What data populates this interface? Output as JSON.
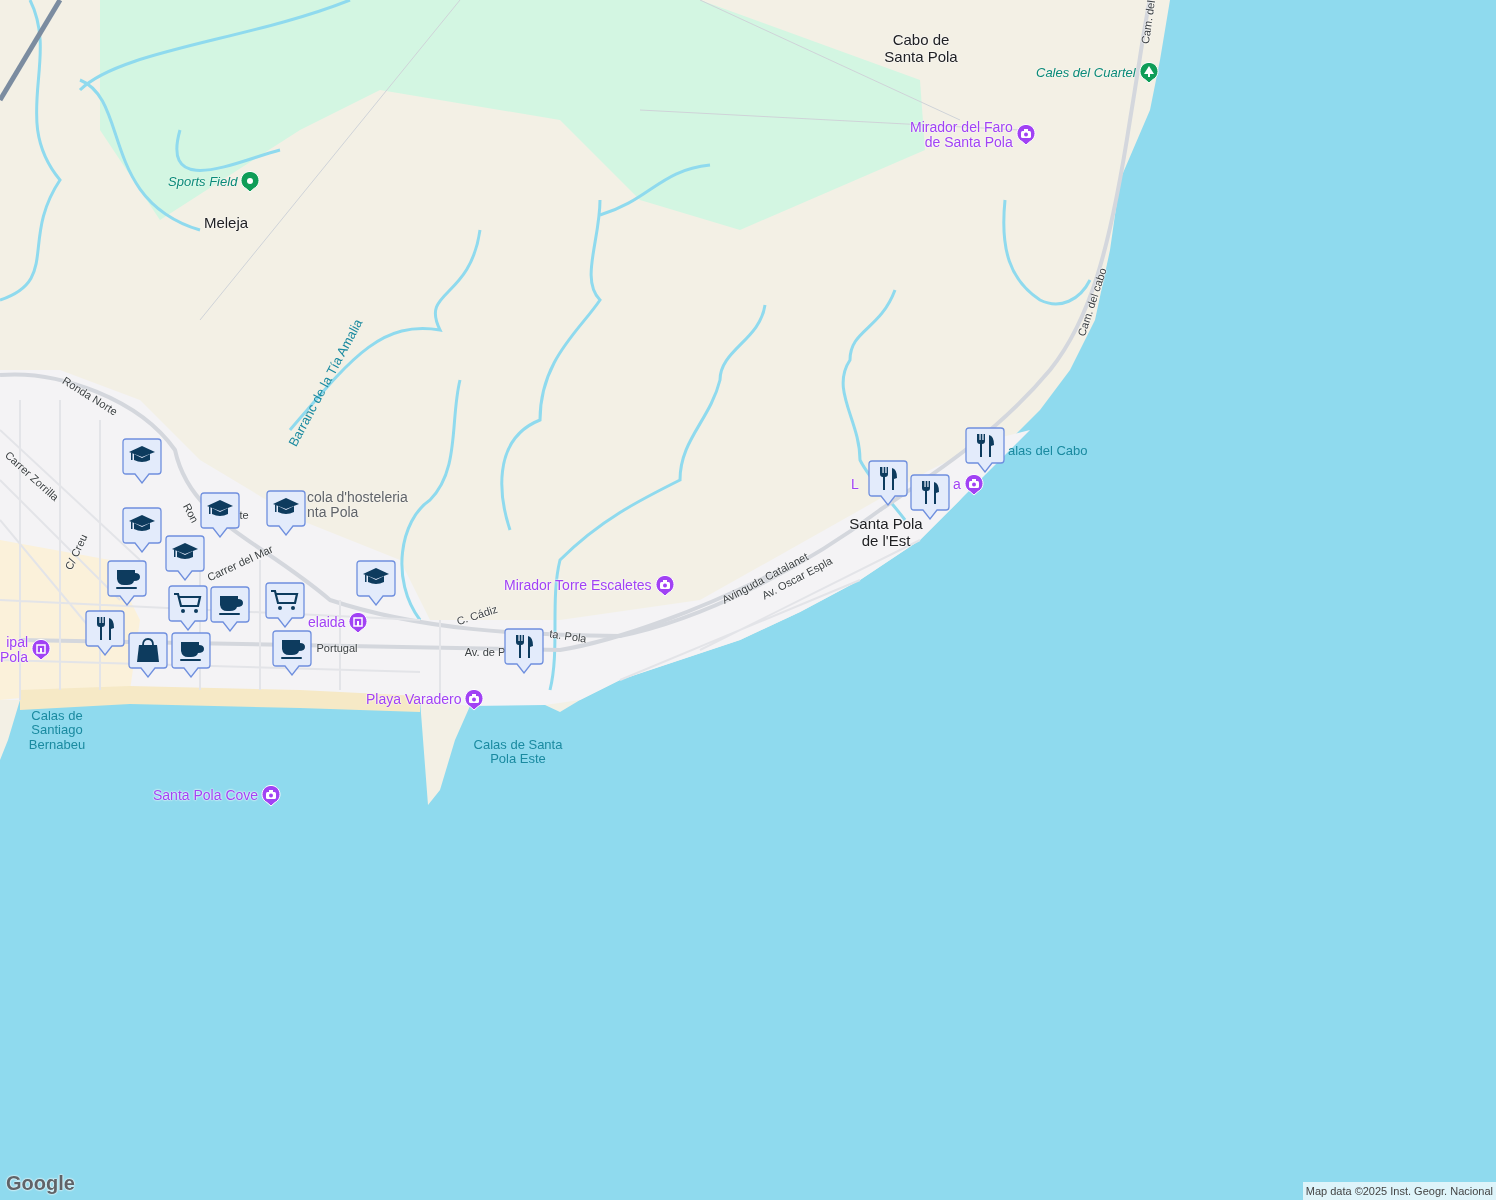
{
  "map": {
    "labels": [
      {
        "kind": "place",
        "lines": [
          "Cabo de",
          "Santa Pola"
        ]
      },
      {
        "kind": "park",
        "lines": [
          "Cales del Cuartel"
        ],
        "pinned": true
      },
      {
        "kind": "poi",
        "lines": [
          "Mirador del Faro",
          "de Santa Pola"
        ],
        "pinned": true
      },
      {
        "kind": "park",
        "lines": [
          "Sports Field"
        ],
        "pinned": true
      },
      {
        "kind": "place",
        "lines": [
          "Meleja"
        ]
      },
      {
        "kind": "water",
        "lines": [
          "Barranc de la Tía Amalia"
        ]
      },
      {
        "kind": "street",
        "lines": [
          "Ronda Norte"
        ]
      },
      {
        "kind": "street",
        "lines": [
          "Carrer Zorrilla"
        ]
      },
      {
        "kind": "street",
        "lines": [
          "C/ Creu"
        ]
      },
      {
        "kind": "street",
        "lines": [
          "Ron"
        ]
      },
      {
        "kind": "street",
        "lines": [
          "te"
        ]
      },
      {
        "kind": "school",
        "lines": [
          "cola d'hosteleria",
          "nta Pola"
        ]
      },
      {
        "kind": "street",
        "lines": [
          "Carrer del Mar"
        ]
      },
      {
        "kind": "poi",
        "lines": [
          "elaida"
        ],
        "pinned": true
      },
      {
        "kind": "street",
        "lines": [
          "Portugal"
        ]
      },
      {
        "kind": "street",
        "lines": [
          "C. Cádiz"
        ]
      },
      {
        "kind": "street",
        "lines": [
          "ta. Pola"
        ]
      },
      {
        "kind": "street",
        "lines": [
          "Av. de P"
        ]
      },
      {
        "kind": "poi",
        "lines": [
          "Mirador Torre Escaletes"
        ],
        "pinned": true
      },
      {
        "kind": "street",
        "lines": [
          "Avinguda Catalanet"
        ]
      },
      {
        "kind": "street",
        "lines": [
          "Av. Oscar Espla"
        ]
      },
      {
        "kind": "poi",
        "lines": [
          "L"
        ]
      },
      {
        "kind": "poi",
        "lines": [
          "a"
        ],
        "pinned": true
      },
      {
        "kind": "place",
        "lines": [
          "Santa Pola",
          "de l'Est"
        ]
      },
      {
        "kind": "water",
        "lines": [
          "alas del Cabo"
        ]
      },
      {
        "kind": "street",
        "lines": [
          "Cam. del cabo"
        ]
      },
      {
        "kind": "street",
        "lines": [
          "Cam. del"
        ]
      },
      {
        "kind": "poi",
        "lines": [
          "ipal",
          "Pola"
        ],
        "pinned": true
      },
      {
        "kind": "water",
        "lines": [
          "Calas de",
          "Santiago",
          "Bernabeu"
        ]
      },
      {
        "kind": "poi",
        "lines": [
          "Playa Varadero"
        ],
        "pinned": true
      },
      {
        "kind": "water",
        "lines": [
          "Calas de Santa",
          "Pola Este"
        ]
      },
      {
        "kind": "poi",
        "lines": [
          "Santa Pola Cove"
        ],
        "pinned": true
      }
    ],
    "markers": [
      {
        "kind": "school"
      },
      {
        "kind": "school"
      },
      {
        "kind": "school"
      },
      {
        "kind": "school"
      },
      {
        "kind": "school"
      },
      {
        "kind": "school"
      },
      {
        "kind": "cafe"
      },
      {
        "kind": "cart"
      },
      {
        "kind": "cart"
      },
      {
        "kind": "cafe"
      },
      {
        "kind": "restaurant"
      },
      {
        "kind": "bag"
      },
      {
        "kind": "cafe"
      },
      {
        "kind": "cafe"
      },
      {
        "kind": "restaurant"
      },
      {
        "kind": "restaurant"
      },
      {
        "kind": "restaurant"
      },
      {
        "kind": "restaurant"
      }
    ],
    "logo": "Google",
    "attribution": "Map data ©2025 Inst. Geogr. Nacional"
  }
}
